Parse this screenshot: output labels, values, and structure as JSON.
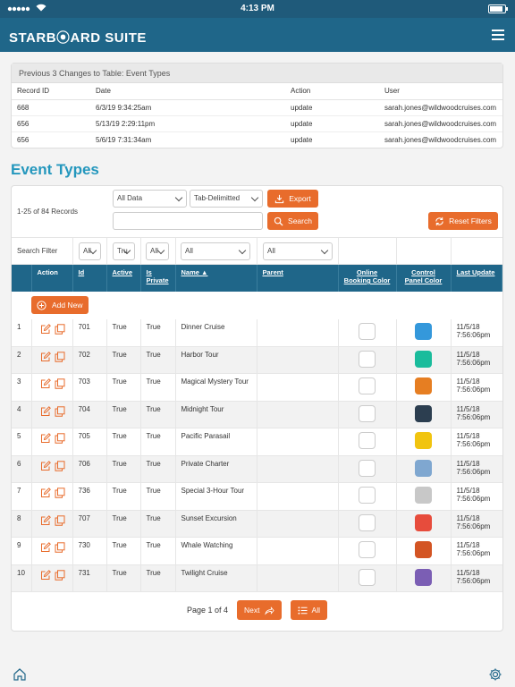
{
  "status_bar": {
    "time": "4:13 PM",
    "battery_level": 0.9
  },
  "header": {
    "logo": "STARB⦿ARD SUITE",
    "menu_icon": "hamburger-menu-icon"
  },
  "changes": {
    "title": "Previous 3 Changes to Table: Event Types",
    "columns": [
      "Record ID",
      "Date",
      "Action",
      "User"
    ],
    "rows": [
      [
        "668",
        "6/3/19 9:34:25am",
        "update",
        "sarah.jones@wildwoodcruises.com"
      ],
      [
        "656",
        "5/13/19 2:29:11pm",
        "update",
        "sarah.jones@wildwoodcruises.com"
      ],
      [
        "656",
        "5/6/19 7:31:34am",
        "update",
        "sarah.jones@wildwoodcruises.com"
      ]
    ]
  },
  "page_title": "Event Types",
  "controls": {
    "record_count": "1-25 of 84 Records",
    "data_select": "All Data",
    "format_select": "Tab-Delimitted",
    "export_label": "Export",
    "search_label": "Search",
    "reset_label": "Reset Filters",
    "search_value": ""
  },
  "filters": {
    "label": "Search Filter",
    "action": "All",
    "active": "Tru",
    "private": "All",
    "name": "All",
    "parent": "All"
  },
  "grid": {
    "headers": {
      "action": "Action",
      "id": "Id",
      "active": "Active",
      "is_private": "Is Private",
      "name": "Name ▲",
      "parent": "Parent",
      "online_color": "Online Booking Color",
      "panel_color": "Control Panel Color",
      "last_update": "Last Update"
    },
    "add_new_label": "Add New",
    "rows": [
      {
        "num": "1",
        "id": "701",
        "active": "True",
        "private": "True",
        "name": "Dinner Cruise",
        "color": "#3498db",
        "update": "11/5/18 7:56:06pm"
      },
      {
        "num": "2",
        "id": "702",
        "active": "True",
        "private": "True",
        "name": "Harbor Tour",
        "color": "#1abc9c",
        "update": "11/5/18 7:56:06pm"
      },
      {
        "num": "3",
        "id": "703",
        "active": "True",
        "private": "True",
        "name": "Magical Mystery Tour",
        "color": "#e67e22",
        "update": "11/5/18 7:56:06pm"
      },
      {
        "num": "4",
        "id": "704",
        "active": "True",
        "private": "True",
        "name": "Midnight Tour",
        "color": "#2c3e50",
        "update": "11/5/18 7:56:06pm"
      },
      {
        "num": "5",
        "id": "705",
        "active": "True",
        "private": "True",
        "name": "Pacific Parasail",
        "color": "#f1c40f",
        "update": "11/5/18 7:56:06pm"
      },
      {
        "num": "6",
        "id": "706",
        "active": "True",
        "private": "True",
        "name": "Private Charter",
        "color": "#7fa7d0",
        "update": "11/5/18 7:56:06pm"
      },
      {
        "num": "7",
        "id": "736",
        "active": "True",
        "private": "True",
        "name": "Special 3-Hour Tour",
        "color": "#c8c8c8",
        "update": "11/5/18 7:56:06pm"
      },
      {
        "num": "8",
        "id": "707",
        "active": "True",
        "private": "True",
        "name": "Sunset Excursion",
        "color": "#e74c3c",
        "update": "11/5/18 7:56:06pm"
      },
      {
        "num": "9",
        "id": "730",
        "active": "True",
        "private": "True",
        "name": "Whale Watching",
        "color": "#d35423",
        "update": "11/5/18 7:56:06pm"
      },
      {
        "num": "10",
        "id": "731",
        "active": "True",
        "private": "True",
        "name": "Twilight Cruise",
        "color": "#7b5eb4",
        "update": "11/5/18 7:56:06pm"
      }
    ]
  },
  "pager": {
    "page_text": "Page 1 of 4",
    "next_label": "Next",
    "all_label": "All"
  },
  "bottom": {
    "home_icon": "home-icon",
    "settings_icon": "settings-gear-icon"
  },
  "colors": {
    "header": "#1f6689",
    "accent": "#e86c2c",
    "title": "#2497bd"
  }
}
